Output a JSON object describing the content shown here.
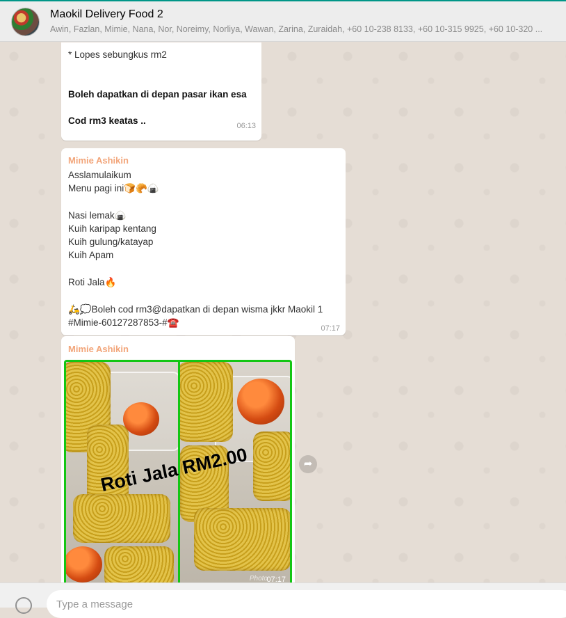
{
  "header": {
    "title": "Maokil Delivery Food 2",
    "members": "Awin, Fazlan, Mimie, Nana, Nor, Noreimy, Norliya, Wawan, Zarina, Zuraidah, +60 10-238 8133, +60 10-315 9925, +60 10-320 ..."
  },
  "messages": [
    {
      "lines": [
        "* Lopes sebungkus rm2",
        "Boleh dapatkan di depan pasar ikan esa",
        "Cod rm3 keatas .."
      ],
      "time": "06:13"
    },
    {
      "sender": "Mimie Ashikin",
      "lines": [
        "Asslamulaikum",
        "Menu pagi ini🍞🥐🍙",
        "Nasi lemak🍙",
        "Kuih karipap kentang",
        "Kuih gulung/katayap",
        "Kuih Apam",
        "Roti Jala🔥",
        "🛵💭Boleh cod rm3@dapatkan di depan wisma jkkr Maokil 1",
        "#Mimie-60127287853-#☎️"
      ],
      "time": "07:17"
    },
    {
      "sender": "Mimie Ashikin",
      "image_text": "Roti Jala RM2.00",
      "watermark": "Photo",
      "time": "07:17"
    }
  ],
  "composer": {
    "placeholder": "Type a message"
  },
  "colors": {
    "header_bg": "#ededed",
    "chat_bg": "#e5ddd5",
    "sender_name": "#f2a57a",
    "photo_border": "#13c613"
  },
  "icons": {
    "forward": "forward-icon",
    "emoji": "emoji-icon"
  }
}
